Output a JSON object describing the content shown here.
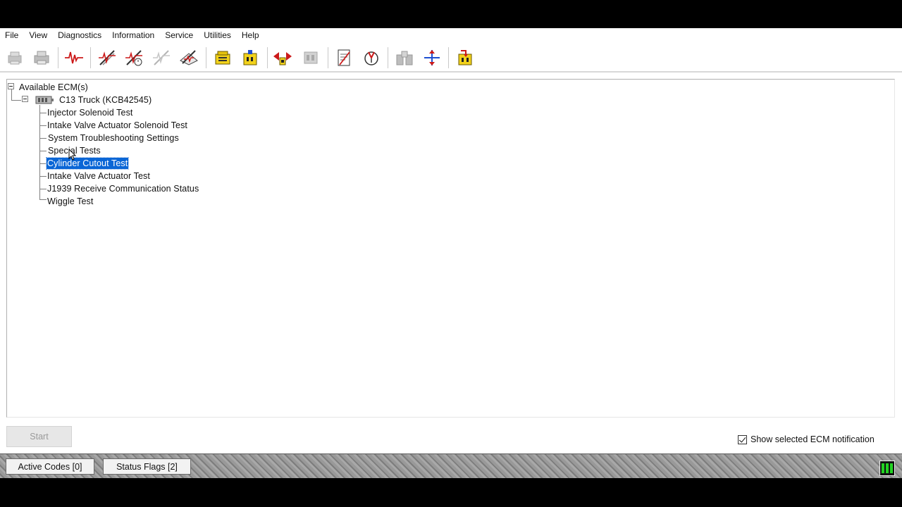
{
  "menu": [
    "File",
    "View",
    "Diagnostics",
    "Information",
    "Service",
    "Utilities",
    "Help"
  ],
  "toolbar": {
    "icons": [
      "print-preview-icon",
      "print-icon",
      "status-waveform-icon",
      "active-diagnostics-icon",
      "logged-events-icon",
      "clear-events-icon",
      "diagnostic-tests-icon",
      "configuration-icon",
      "calibration-icon",
      "ecm-compare-icon",
      "ecm-summary-icon",
      "data-log-icon",
      "product-status-icon",
      "ecm-replacement-icon",
      "connect-icon",
      "flash-icon"
    ]
  },
  "tree": {
    "root": "Available ECM(s)",
    "ecm": "C13 Truck (KCB42545)",
    "items": [
      "Injector Solenoid Test",
      "Intake Valve Actuator Solenoid Test",
      "System Troubleshooting Settings",
      "Special Tests",
      "Cylinder Cutout Test",
      "Intake Valve Actuator Test",
      "J1939 Receive Communication Status",
      "Wiggle Test"
    ],
    "selected_index": 4
  },
  "start_label": "Start",
  "notification": {
    "label": "Show selected ECM notification",
    "checked": true
  },
  "status": {
    "active_codes": "Active Codes [0]",
    "status_flags": "Status Flags [2]",
    "connection_color": "#22d322"
  },
  "colors": {
    "selection": "#0a66d6",
    "icon_red": "#cc1a1a",
    "icon_yellow": "#f2d21b",
    "icon_blue": "#1f4fd1"
  }
}
